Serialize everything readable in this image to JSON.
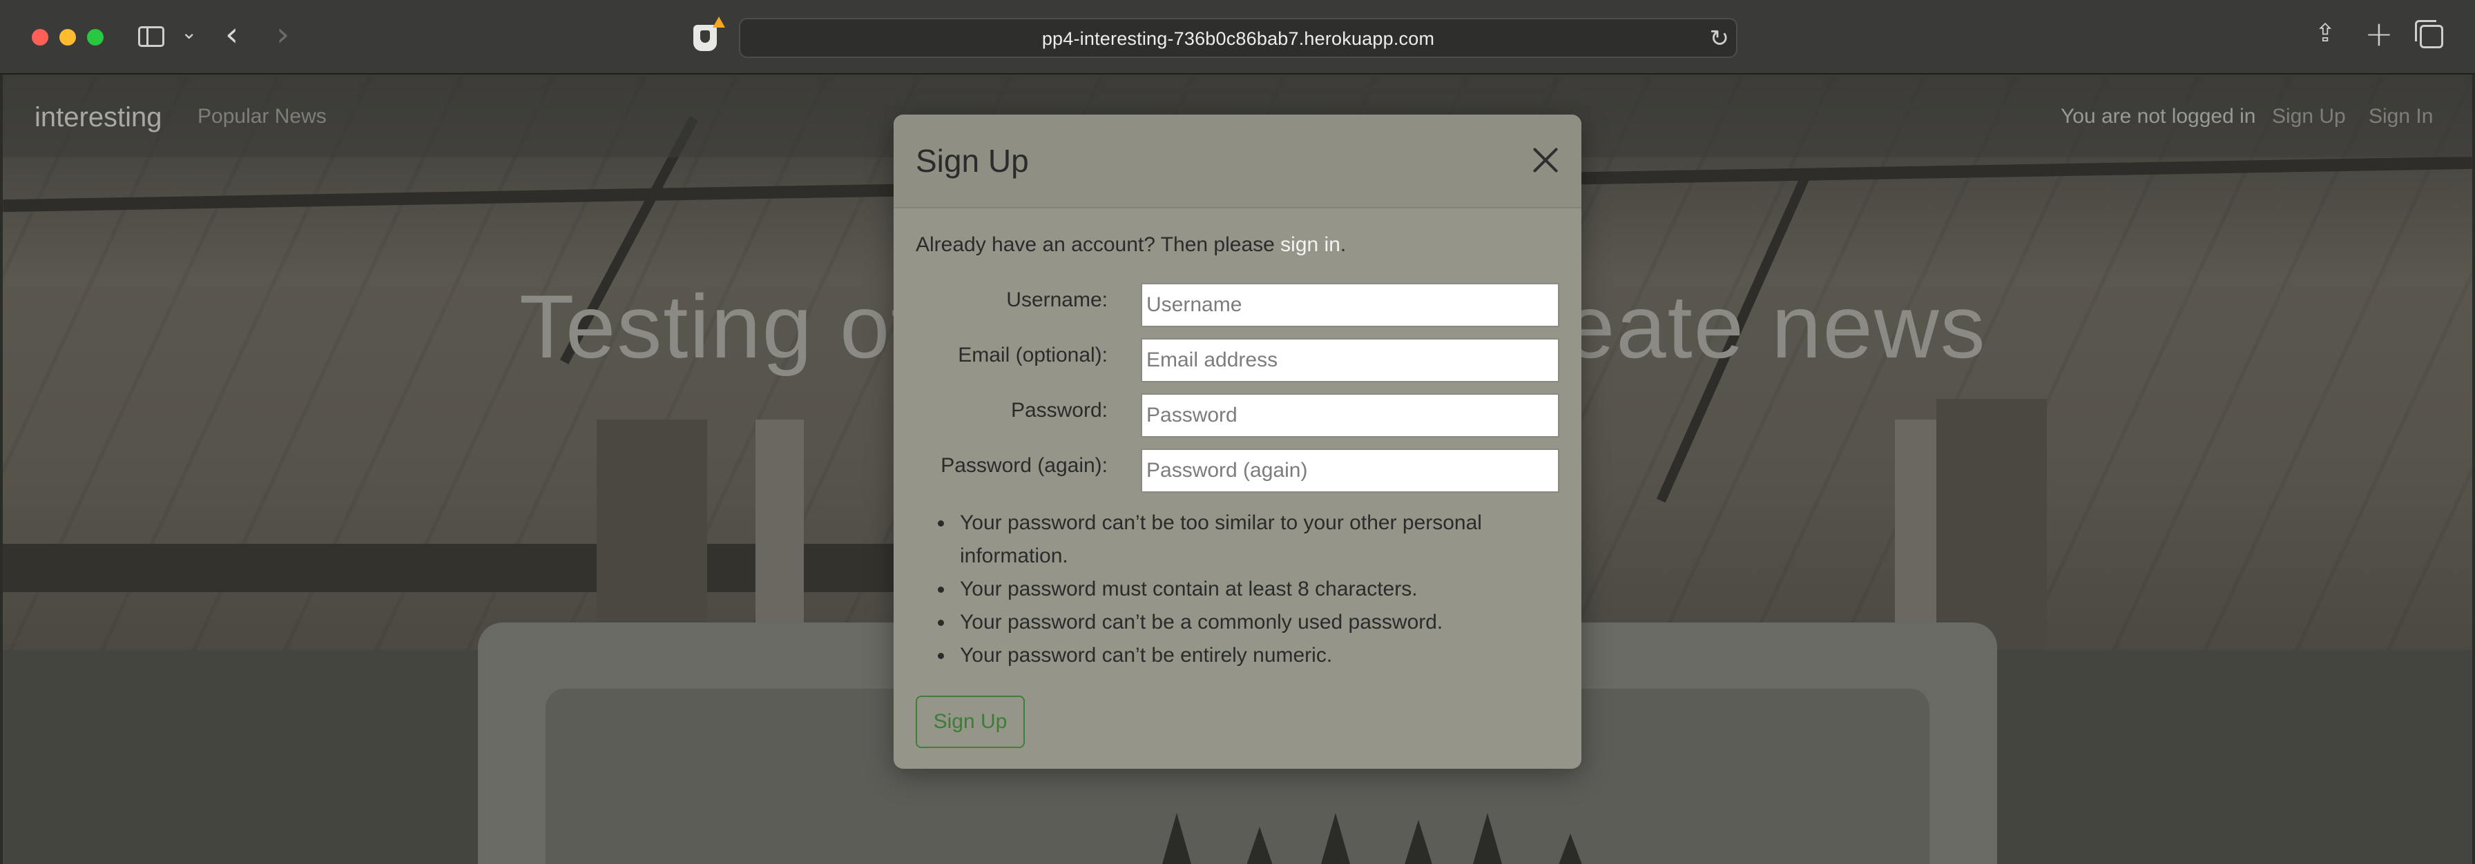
{
  "browser": {
    "url": "pp4-interesting-736b0c86bab7.herokuapp.com"
  },
  "site": {
    "brand": "interesting",
    "nav_popular": "Popular News",
    "login_status": "You are not logged in",
    "nav_signup": "Sign Up",
    "nav_signin": "Sign In",
    "hero_left": "Testing of",
    "hero_right": "eate news"
  },
  "modal": {
    "title": "Sign Up",
    "intro_prefix": "Already have an account? Then please ",
    "intro_link": "sign in",
    "intro_suffix": ".",
    "fields": [
      {
        "label": "Username:",
        "placeholder": "Username"
      },
      {
        "label": "Email (optional):",
        "placeholder": "Email address"
      },
      {
        "label": "Password:",
        "placeholder": "Password"
      },
      {
        "label": "Password (again):",
        "placeholder": "Password (again)"
      }
    ],
    "help": [
      "Your password can’t be too similar to your other personal information.",
      "Your password must contain at least 8 characters.",
      "Your password can’t be a commonly used password.",
      "Your password can’t be entirely numeric."
    ],
    "submit_label": "Sign Up"
  }
}
